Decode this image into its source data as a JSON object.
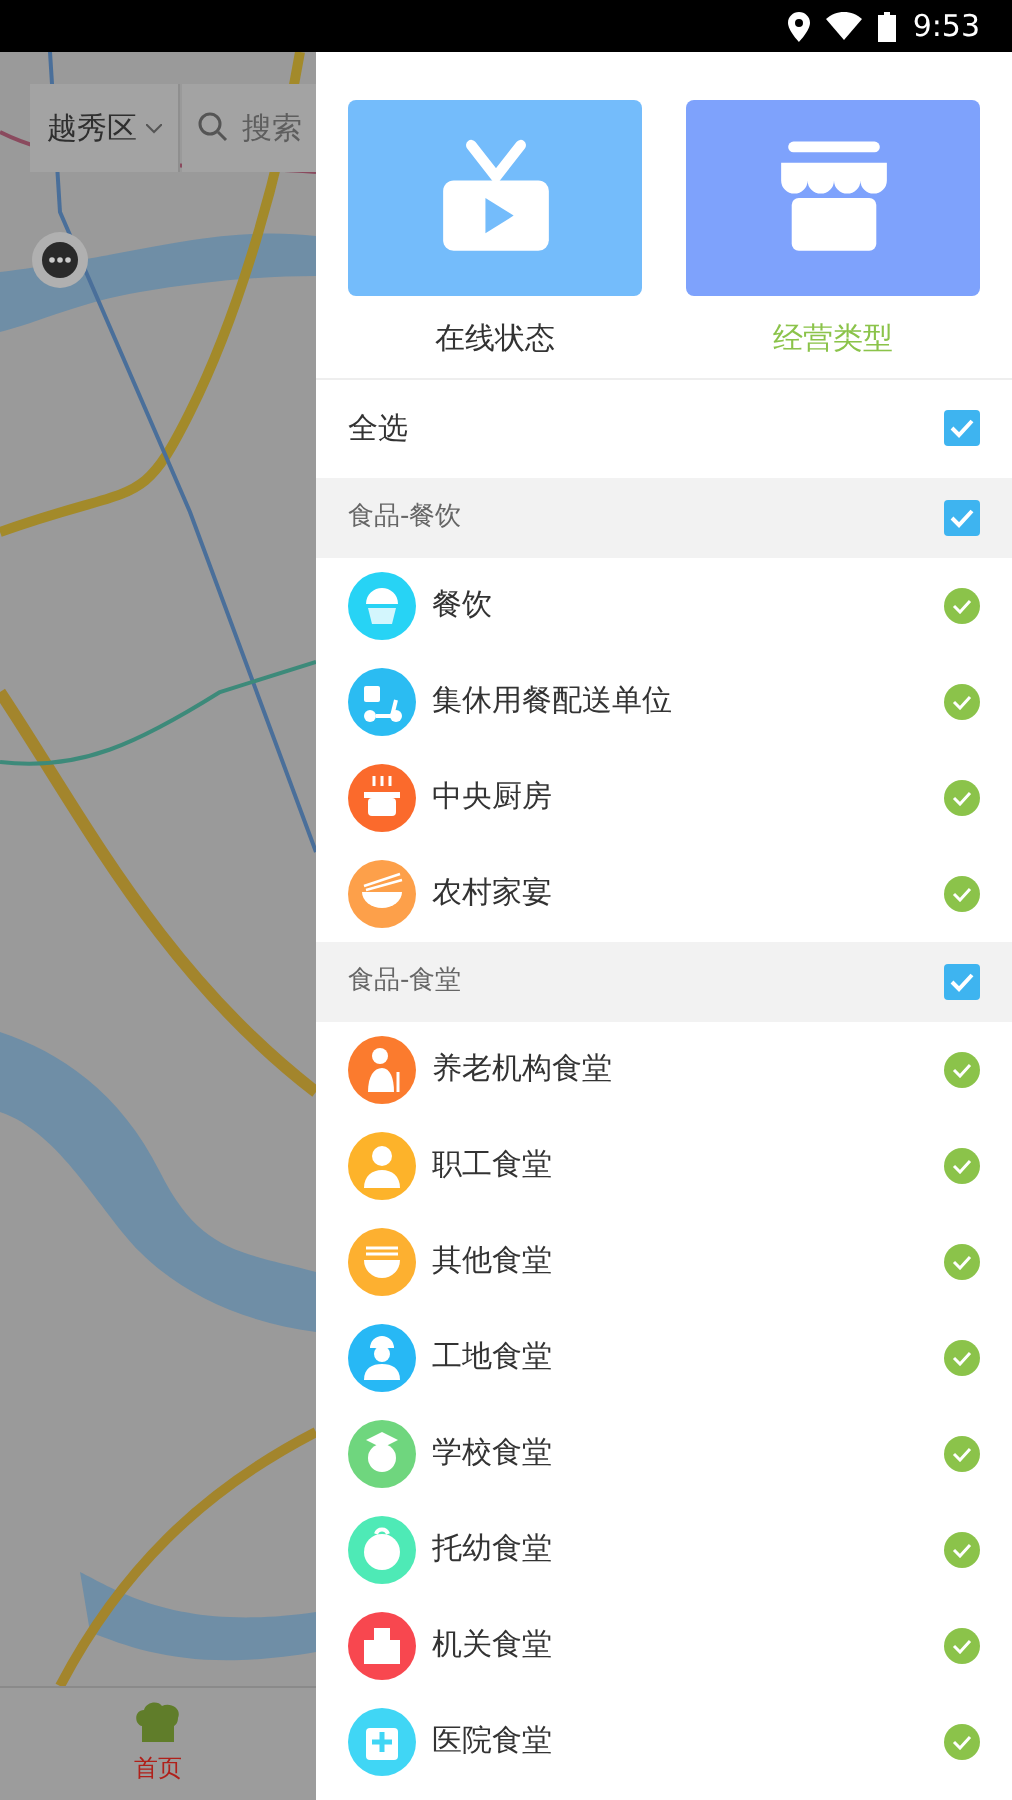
{
  "status_bar": {
    "time": "9:53"
  },
  "map": {
    "district": "越秀区",
    "search": {
      "placeholder": "搜索"
    }
  },
  "bottom_nav": [
    {
      "label": "首页",
      "selected": true
    }
  ],
  "drawer": {
    "tabs": [
      {
        "label": "在线状态",
        "kind": "tv",
        "color": "#74bcfb",
        "selected": false
      },
      {
        "label": "经营类型",
        "kind": "store",
        "color": "#7ea2fc",
        "selected": true
      }
    ],
    "select_all": {
      "label": "全选",
      "checked": true
    },
    "groups": [
      {
        "title": "食品-餐饮",
        "checked": true,
        "items": [
          {
            "name": "餐饮",
            "kind": "cupcake",
            "color": "#27d3f5",
            "checked": true
          },
          {
            "name": "集休用餐配送单位",
            "kind": "scooter",
            "color": "#2bbcf2",
            "checked": true
          },
          {
            "name": "中央厨房",
            "kind": "pot",
            "color": "#fb6a2c",
            "checked": true
          },
          {
            "name": "农村家宴",
            "kind": "bowl",
            "color": "#fda04a",
            "checked": true
          }
        ]
      },
      {
        "title": "食品-食堂",
        "checked": true,
        "items": [
          {
            "name": "养老机构食堂",
            "kind": "elder",
            "color": "#fb7b2e",
            "checked": true
          },
          {
            "name": "职工食堂",
            "kind": "worker",
            "color": "#fdb32a",
            "checked": true
          },
          {
            "name": "其他食堂",
            "kind": "noodles",
            "color": "#fdb030",
            "checked": true
          },
          {
            "name": "工地食堂",
            "kind": "helmet",
            "color": "#27b8f5",
            "checked": true
          },
          {
            "name": "学校食堂",
            "kind": "graduate",
            "color": "#6fd67e",
            "checked": true
          },
          {
            "name": "托幼食堂",
            "kind": "baby",
            "color": "#4eeab6",
            "checked": true
          },
          {
            "name": "机关食堂",
            "kind": "building",
            "color": "#f8474f",
            "checked": true
          },
          {
            "name": "医院食堂",
            "kind": "hospital",
            "color": "#40d6f5",
            "checked": true
          }
        ]
      }
    ]
  }
}
